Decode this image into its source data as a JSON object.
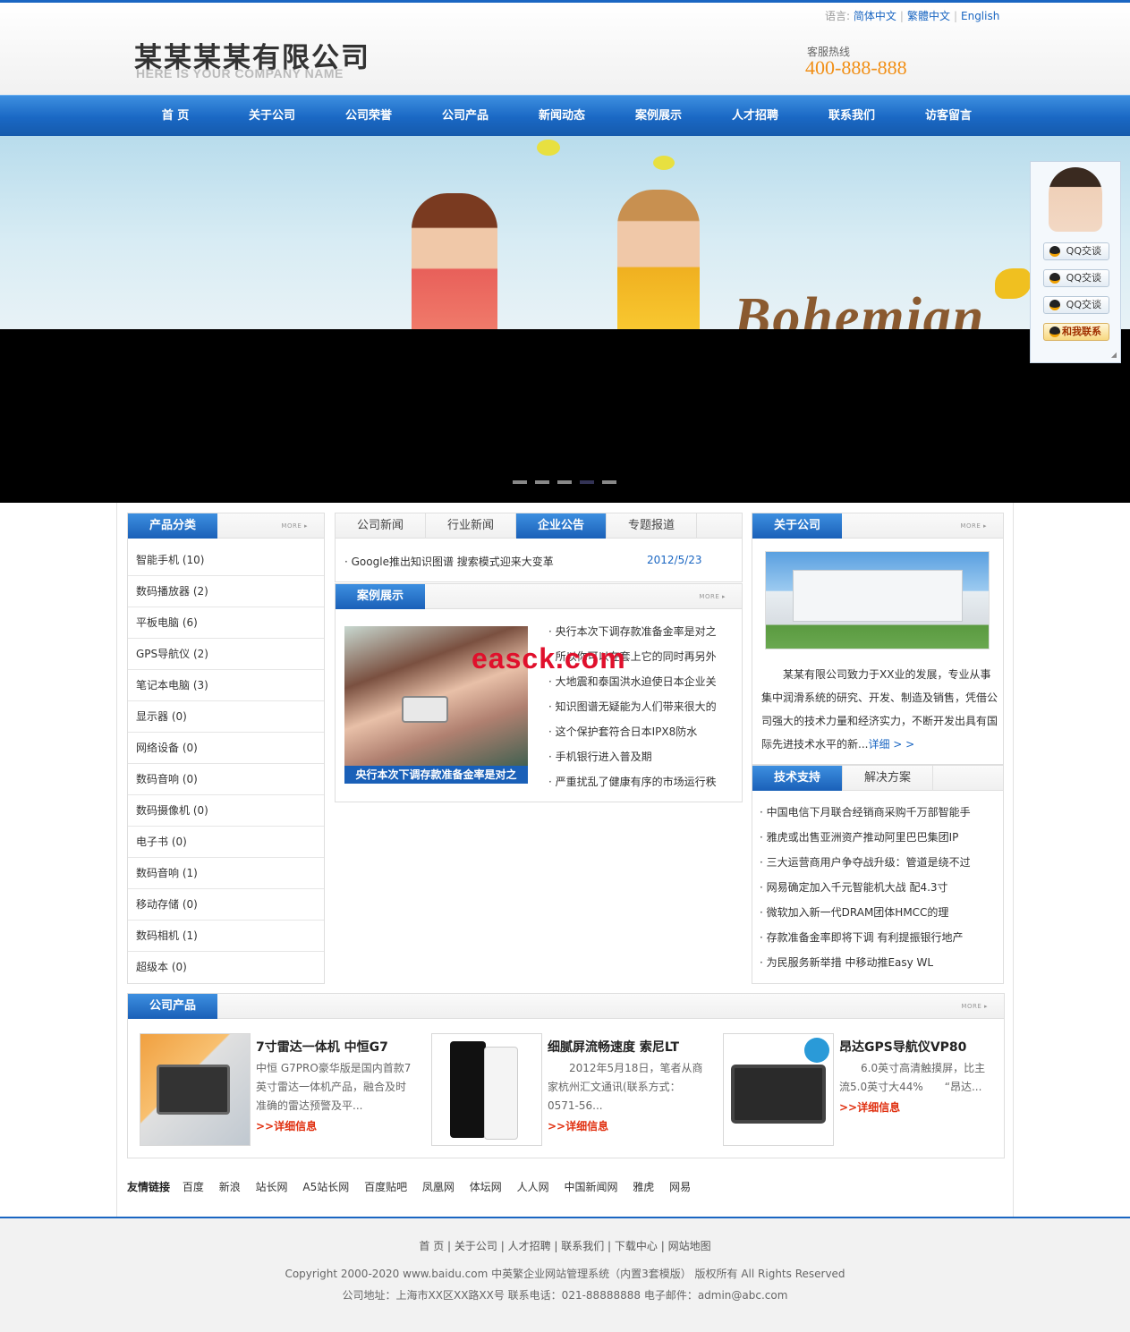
{
  "header": {
    "lang_label": "语言:",
    "langs": [
      "简体中文",
      "繁體中文",
      "English"
    ],
    "logo_main": "某某某某有限公司",
    "logo_sub": "HERE IS YOUR COMPANY NAME",
    "hotline_label": "客服热线",
    "hotline_number": "400-888-888"
  },
  "nav": [
    "首 页",
    "关于公司",
    "公司荣誉",
    "公司产品",
    "新闻动态",
    "案例展示",
    "人才招聘",
    "联系我们",
    "访客留言"
  ],
  "banner": {
    "word": "Bohemian",
    "slides": 5,
    "active_slide": 4
  },
  "qq_panel": {
    "buttons": [
      "QQ交谈",
      "QQ交谈",
      "QQ交谈"
    ],
    "contact": "和我联系"
  },
  "more_label": "MORE",
  "categories": {
    "title": "产品分类",
    "items": [
      "智能手机 (10)",
      "数码播放器 (2)",
      "平板电脑 (6)",
      "GPS导航仪 (2)",
      "笔记本电脑 (3)",
      "显示器 (0)",
      "网络设备 (0)",
      "数码音响 (0)",
      "数码摄像机 (0)",
      "电子书 (0)",
      "数码音响 (1)",
      "移动存储 (0)",
      "数码相机 (1)",
      "超级本 (0)"
    ]
  },
  "news": {
    "tabs": [
      "公司新闻",
      "行业新闻",
      "企业公告",
      "专题报道"
    ],
    "active_tab": 2,
    "item_title": "· Google推出知识图谱 搜索模式迎来大变革",
    "item_date": "2012/5/23"
  },
  "cases": {
    "title": "案例展示",
    "caption": "央行本次下调存款准备金率是对之",
    "items": [
      "央行本次下调存款准备金率是对之",
      "所以你可以在套上它的同时再另外",
      "大地震和泰国洪水迫使日本企业关",
      "知识图谱无疑能为人们带来很大的",
      "这个保护套符合日本IPX8防水",
      "手机银行进入普及期",
      "严重扰乱了健康有序的市场运行秩"
    ]
  },
  "about": {
    "title": "关于公司",
    "text": "某某有限公司致力于XX业的发展，专业从事集中润滑系统的研究、开发、制造及销售，凭借公司强大的技术力量和经济实力，不断开发出具有国际先进技术水平的新...",
    "more": "详细 > >"
  },
  "support": {
    "tabs": [
      "技术支持",
      "解决方案"
    ],
    "items": [
      "中国电信下月联合经销商采购千万部智能手",
      "雅虎或出售亚洲资产推动阿里巴巴集团IP",
      "三大运营商用户争夺战升级：管道是绕不过",
      "网易确定加入千元智能机大战 配4.3寸",
      "微软加入新一代DRAM团体HMCC的理",
      "存款准备金率即将下调 有利提振银行地产",
      "为民服务新举措 中移动推Easy WL"
    ]
  },
  "products": {
    "title": "公司产品",
    "items": [
      {
        "title": "7寸雷达一体机 中恒G7",
        "desc": "中恒 G7PRO豪华版是国内首款7英寸雷达一体机产品，融合及时准确的雷达预警及平...",
        "link": ">>详细信息"
      },
      {
        "title": "细腻屏流畅速度 索尼LT",
        "desc": "　　2012年5月18日，笔者从商家杭州汇文通讯(联系方式：0571-56...",
        "link": ">>详细信息"
      },
      {
        "title": "昂达GPS导航仪VP80",
        "desc": "　　6.0英寸高清触摸屏，比主流5.0英寸大44%　　“昂达...",
        "link": ">>详细信息"
      }
    ]
  },
  "friends": {
    "label": "友情链接",
    "links": [
      "百度",
      "新浪",
      "站长网",
      "A5站长网",
      "百度贴吧",
      "凤凰网",
      "体坛网",
      "人人网",
      "中国新闻网",
      "雅虎",
      "网易"
    ]
  },
  "footer": {
    "links": "首 页 | 关于公司 | 人才招聘 | 联系我们 | 下载中心 | 网站地图",
    "copyright": "Copyright 2000-2020 www.baidu.com 中英繁企业网站管理系统（内置3套模版） 版权所有 All Rights Reserved",
    "address": "公司地址：上海市XX区XX路XX号 联系电话：021-88888888 电子邮件：admin@abc.com"
  },
  "watermark": "easck.com",
  "colors": {
    "brand_blue": "#1a66c2",
    "hotline_orange": "#f18f16",
    "link_red": "#e03010"
  }
}
